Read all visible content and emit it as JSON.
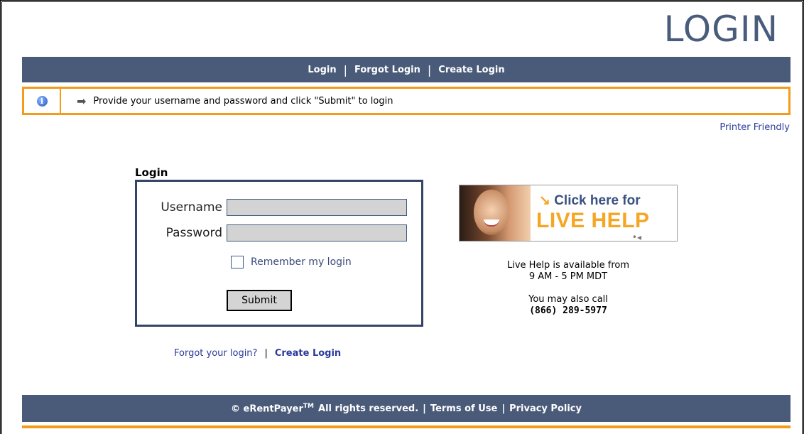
{
  "page": {
    "title": "LOGIN"
  },
  "nav": {
    "login": "Login",
    "forgot_login": "Forgot Login",
    "create_login": "Create Login",
    "separator": "|"
  },
  "info": {
    "icon": "info-icon",
    "arrow_icon": "arrow-right-icon",
    "message": "Provide your username and password and click \"Submit\" to login"
  },
  "printer_friendly": "Printer Friendly",
  "login_form": {
    "heading": "Login",
    "username_label": "Username",
    "username_value": "",
    "password_label": "Password",
    "password_value": "",
    "remember_label": "Remember my login",
    "remember_checked": false,
    "submit_label": "Submit"
  },
  "links": {
    "forgot": "Forgot your login?",
    "separator": "|",
    "create": "Create Login"
  },
  "live_help": {
    "click_text": "Click here for",
    "help_text": "LIVE HELP",
    "availability_1": "Live Help is available from",
    "availability_2": "9 AM - 5 PM MDT",
    "call_text": "You may also call",
    "phone": "(866) 289-5977"
  },
  "footer": {
    "copyright": "© eRentPayer",
    "tm": "TM",
    "rights": "All rights reserved.",
    "separator": "|",
    "terms": "Terms of Use",
    "privacy": "Privacy Policy"
  },
  "colors": {
    "nav_bg": "#4a5b7a",
    "accent_orange": "#f39b1a",
    "title_color": "#4a5c7b",
    "link_color": "#2b3a9c"
  }
}
